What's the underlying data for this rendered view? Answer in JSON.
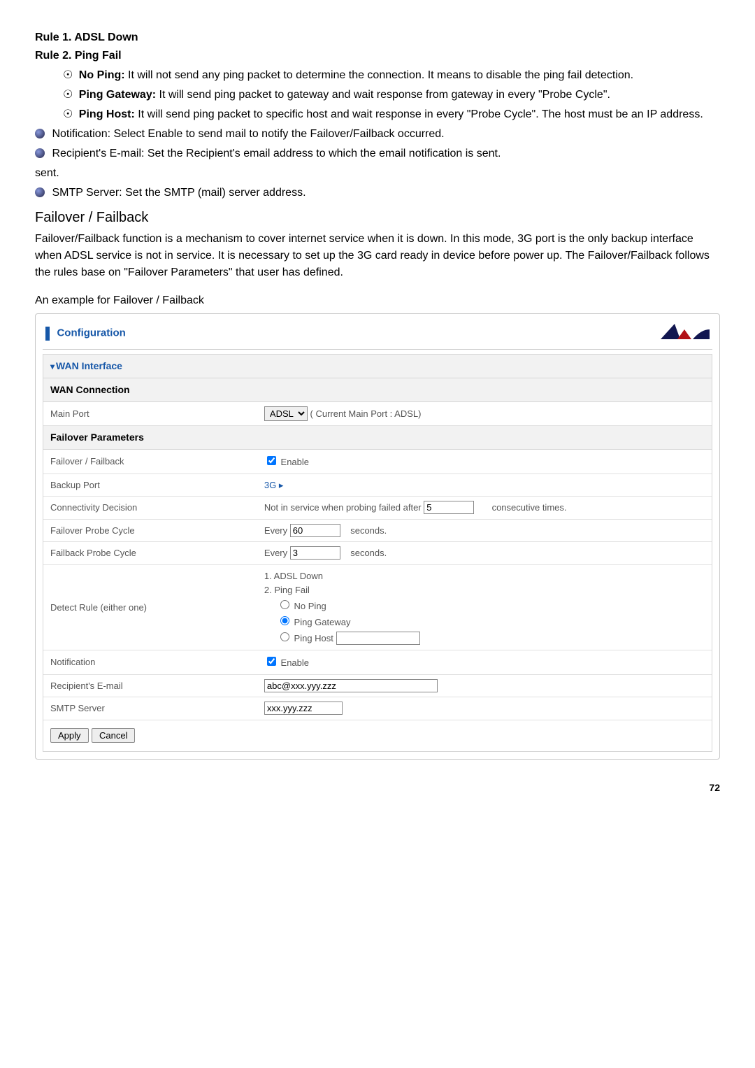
{
  "rules": {
    "r1": "Rule 1. ADSL Down",
    "r2": "Rule 2. Ping Fail",
    "noping_label": "No Ping:",
    "noping_desc": " It will not send any ping packet to determine the connection. It means to disable the ping fail detection.",
    "pinggw_label": "Ping Gateway:",
    "pinggw_desc": " It will send ping packet to gateway and wait response from gateway in every \"Probe Cycle\".",
    "pinghost_label": "Ping Host:",
    "pinghost_desc": " It will send ping packet to specific host and wait response in every \"Probe Cycle\". The host must be an IP address."
  },
  "top": {
    "notif_label": "Notification:",
    "notif_desc": " Select ",
    "notif_bold": "Enable",
    "notif_tail": " to send mail to notify the Failover/Failback occurred.",
    "recip_label": "Recipient's E-mail:",
    "recip_desc": " Set the Recipient's email address to which the email notification is sent.",
    "smtp_label": "SMTP Server:",
    "smtp_desc": " Set the SMTP (mail) server address."
  },
  "section": {
    "title": "Failover / Failback",
    "desc": "Failover/Failback function is a mechanism to cover internet service when it is down. In this mode, 3G port is the only backup interface when ADSL service is not in service. It is necessary to set up the 3G card ready in device before power up. The Failover/Failback follows the rules base on \"Failover Parameters\" that user has defined.",
    "example": "An example for Failover / Failback"
  },
  "panel": {
    "header": "Configuration",
    "wan_interface": "WAN Interface",
    "wan_connection": "WAN Connection",
    "main_port": "Main Port",
    "main_port_sel": "ADSL",
    "main_port_note": "( Current Main Port : ADSL)",
    "failover_params": "Failover Parameters",
    "row_failover": "Failover / Failback",
    "enable": "Enable",
    "row_backup": "Backup Port",
    "backup_val": "3G ▸",
    "row_conn": "Connectivity Decision",
    "conn_pre": "Not in service when probing failed after",
    "conn_input": "5",
    "conn_post": "consecutive times.",
    "row_fopc": "Failover Probe Cycle",
    "fopc_every": "Every",
    "fopc_input": "60",
    "seconds": "seconds.",
    "row_fbpc": "Failback Probe Cycle",
    "fbpc_input": "3",
    "row_detect": "Detect Rule (either one)",
    "dr1": "1. ADSL Down",
    "dr2": "2. Ping Fail",
    "dr_noping": "No Ping",
    "dr_gateway": "Ping Gateway",
    "dr_host": "Ping Host",
    "row_notif": "Notification",
    "row_recip": "Recipient's E-mail",
    "recip_val": "abc@xxx.yyy.zzz",
    "row_smtp": "SMTP Server",
    "smtp_val": "xxx.yyy.zzz",
    "apply": "Apply",
    "cancel": "Cancel"
  },
  "page": "72"
}
